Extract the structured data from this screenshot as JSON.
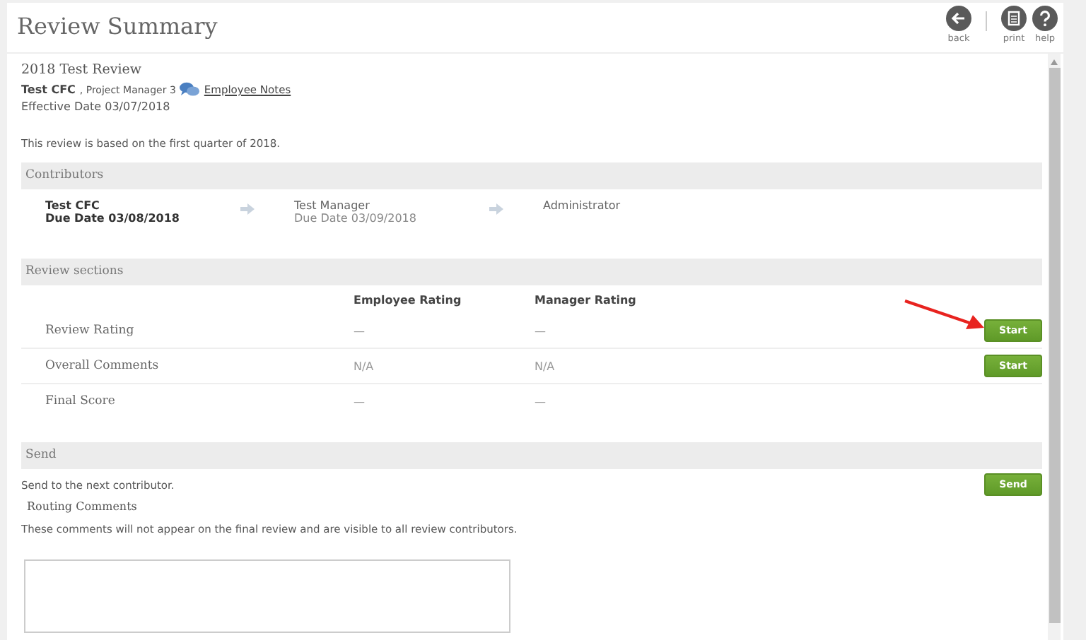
{
  "header": {
    "title": "Review Summary",
    "actions": [
      {
        "kind": "back",
        "label": "back"
      },
      {
        "kind": "print",
        "label": "print"
      },
      {
        "kind": "help",
        "label": "help"
      }
    ]
  },
  "review": {
    "title": "2018 Test Review",
    "employee": "Test CFC",
    "role": ", Project Manager 3",
    "notes_link": "Employee Notes",
    "effective_date": "Effective Date 03/07/2018",
    "description": "This review is based on the first quarter of 2018."
  },
  "contributors": {
    "heading": "Contributors",
    "items": [
      {
        "name": "Test CFC",
        "due": "Due Date 03/08/2018",
        "current": true
      },
      {
        "name": "Test Manager",
        "due": "Due Date 03/09/2018",
        "current": false
      },
      {
        "name": "Administrator",
        "current": false
      }
    ]
  },
  "review_sections": {
    "heading": "Review sections",
    "columns": [
      "Employee Rating",
      "Manager Rating"
    ],
    "rows": [
      {
        "label": "Review Rating",
        "employee": "—",
        "manager": "—",
        "button": "Start"
      },
      {
        "label": "Overall Comments",
        "employee": "N/A",
        "manager": "N/A",
        "button": "Start"
      },
      {
        "label": "Final Score",
        "employee": "—",
        "manager": "—"
      }
    ]
  },
  "send": {
    "heading": "Send",
    "text": "Send to the next contributor.",
    "button": "Send",
    "comments_label": "Routing Comments",
    "comments_hint": "These comments will not appear on the final review and are visible to all review contributors."
  }
}
